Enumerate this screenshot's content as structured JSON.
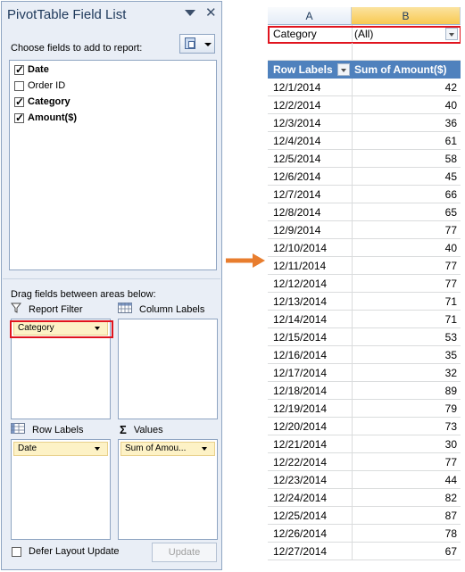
{
  "panel": {
    "title": "PivotTable Field List",
    "close_glyph": "✕",
    "choose_label": "Choose fields to add to report:",
    "fields": [
      {
        "label": "Date",
        "checked": true,
        "bold": true
      },
      {
        "label": "Order ID",
        "checked": false,
        "bold": false
      },
      {
        "label": "Category",
        "checked": true,
        "bold": true
      },
      {
        "label": "Amount($)",
        "checked": true,
        "bold": true
      }
    ],
    "drag_label": "Drag fields between areas below:",
    "areas": {
      "report_filter": {
        "label": "Report Filter",
        "chip": "Category"
      },
      "column_labels": {
        "label": "Column Labels"
      },
      "row_labels": {
        "label": "Row Labels",
        "chip": "Date"
      },
      "values": {
        "label": "Values",
        "chip": "Sum of Amou..."
      }
    },
    "values_sigma": "Σ",
    "defer_label": "Defer Layout Update",
    "update_label": "Update"
  },
  "sheet": {
    "columns": [
      "A",
      "B"
    ],
    "filter": {
      "name": "Category",
      "value": "(All)"
    },
    "header": {
      "row_labels": "Row Labels",
      "sum": "Sum of Amount($)"
    },
    "rows": [
      {
        "date": "12/1/2014",
        "amount": "42"
      },
      {
        "date": "12/2/2014",
        "amount": "40"
      },
      {
        "date": "12/3/2014",
        "amount": "36"
      },
      {
        "date": "12/4/2014",
        "amount": "61"
      },
      {
        "date": "12/5/2014",
        "amount": "58"
      },
      {
        "date": "12/6/2014",
        "amount": "45"
      },
      {
        "date": "12/7/2014",
        "amount": "66"
      },
      {
        "date": "12/8/2014",
        "amount": "65"
      },
      {
        "date": "12/9/2014",
        "amount": "77"
      },
      {
        "date": "12/10/2014",
        "amount": "40"
      },
      {
        "date": "12/11/2014",
        "amount": "77"
      },
      {
        "date": "12/12/2014",
        "amount": "77"
      },
      {
        "date": "12/13/2014",
        "amount": "71"
      },
      {
        "date": "12/14/2014",
        "amount": "71"
      },
      {
        "date": "12/15/2014",
        "amount": "53"
      },
      {
        "date": "12/16/2014",
        "amount": "35"
      },
      {
        "date": "12/17/2014",
        "amount": "32"
      },
      {
        "date": "12/18/2014",
        "amount": "89"
      },
      {
        "date": "12/19/2014",
        "amount": "79"
      },
      {
        "date": "12/20/2014",
        "amount": "73"
      },
      {
        "date": "12/21/2014",
        "amount": "30"
      },
      {
        "date": "12/22/2014",
        "amount": "77"
      },
      {
        "date": "12/23/2014",
        "amount": "44"
      },
      {
        "date": "12/24/2014",
        "amount": "82"
      },
      {
        "date": "12/25/2014",
        "amount": "87"
      },
      {
        "date": "12/26/2014",
        "amount": "78"
      },
      {
        "date": "12/27/2014",
        "amount": "67"
      }
    ]
  },
  "colors": {
    "highlight": "#e0141e",
    "arrow": "#e87d2e",
    "header_blue": "#4f81bd",
    "selected_column": "#f8c951"
  },
  "icons": {
    "arrow": "right-arrow-icon",
    "filter": "filter-funnel-icon",
    "column": "column-grid-icon",
    "row": "row-grid-icon",
    "values": "sigma-icon"
  }
}
